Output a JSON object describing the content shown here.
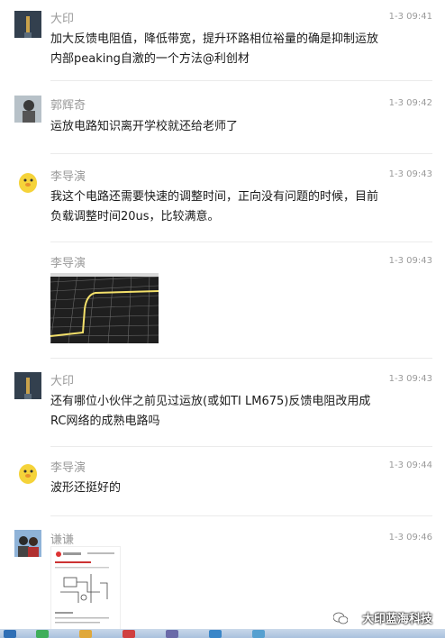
{
  "messages": [
    {
      "name": "大印",
      "time": "1-3 09:41",
      "text": "加大反馈电阻值，降低带宽，提升环路相位裕量的确是抑制运放\n内部peaking自激的一个方法@利创材"
    },
    {
      "name": "郭辉奇",
      "time": "1-3 09:42",
      "text": "运放电路知识离开学校就还给老师了"
    },
    {
      "name": "李导演",
      "time": "1-3 09:43",
      "text": "我这个电路还需要快速的调整时间，正向没有问题的时候，目前\n负载调整时间20us，比较满意。"
    },
    {
      "name": "李导演",
      "time": "1-3 09:43"
    },
    {
      "name": "大印",
      "time": "1-3 09:43",
      "text": "还有哪位小伙伴之前见过运放(或如TI LM675)反馈电阻改用成\nRC网络的成熟电路吗"
    },
    {
      "name": "李导演",
      "time": "1-3 09:44",
      "text": "波形还挺好的"
    },
    {
      "name": "谦谦",
      "time": "1-3 09:46"
    }
  ],
  "watermark": "大印蓝海科技"
}
